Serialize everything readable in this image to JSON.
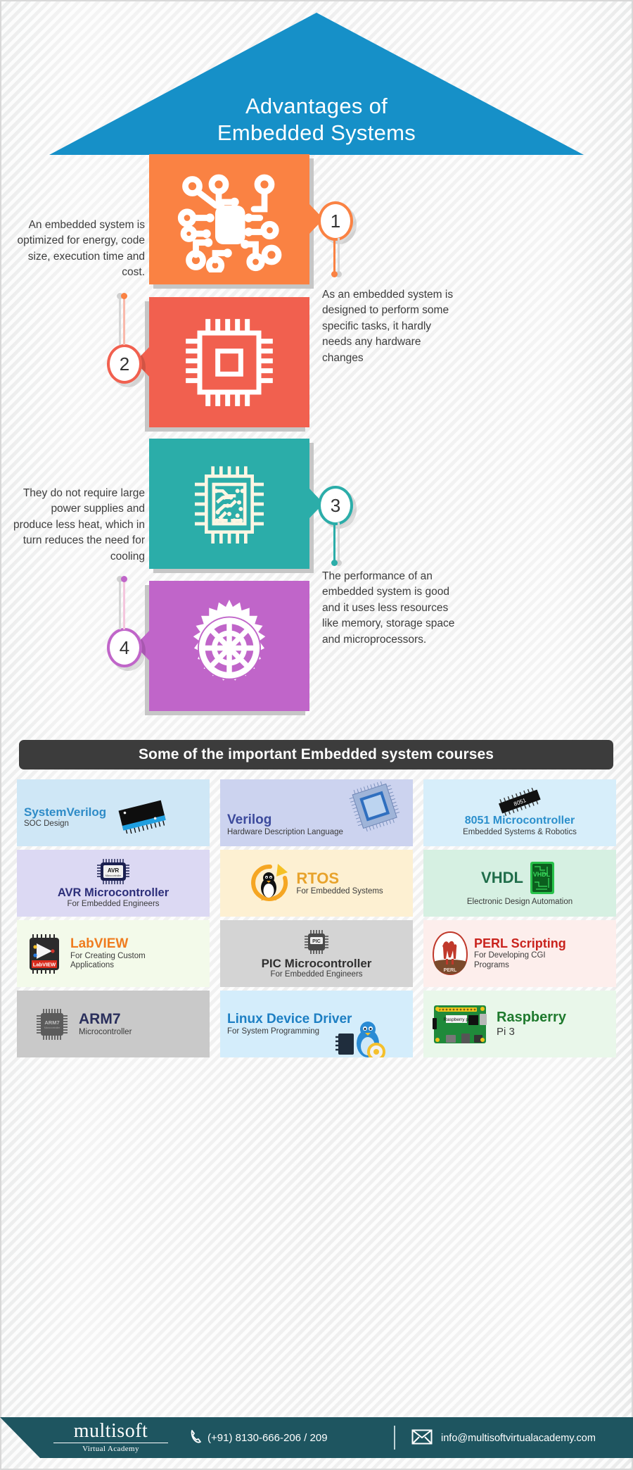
{
  "title": {
    "line1": "Advantages of",
    "line2": "Embedded Systems"
  },
  "accent": {
    "blue": "#1690c8",
    "orange": "#fa8243",
    "red": "#f1604f",
    "teal": "#2bada9",
    "purple": "#c065c9",
    "dark": "#3c3c3c",
    "footer": "#1e5560"
  },
  "points": [
    {
      "number": "1",
      "icon": "circuit-board-icon",
      "color": "#fa8243",
      "text": "An embedded system is optimized for energy, code size, execution time and cost.",
      "side": "left"
    },
    {
      "number": "2",
      "icon": "microchip-icon",
      "color": "#f1604f",
      "text": "As an embedded system is designed to perform some specific tasks, it hardly needs any hardware changes",
      "side": "right"
    },
    {
      "number": "3",
      "icon": "processor-traces-icon",
      "color": "#2bada9",
      "text": "They do not require large power supplies and produce less heat, which in turn reduces the need for cooling",
      "side": "left"
    },
    {
      "number": "4",
      "icon": "gear-icon",
      "color": "#c065c9",
      "text": "The performance of an embedded system is good and it uses less resources like memory, storage space and microprocessors.",
      "side": "right"
    }
  ],
  "courses_banner": "Some of the important Embedded system courses",
  "courses": [
    {
      "name": "SystemVerilog",
      "sub": "SOC Design",
      "bg": "#cfe7f6",
      "name_color": "#2e8bc7",
      "logo": "soc-chip-icon",
      "layout": "text-left"
    },
    {
      "name": "Verilog",
      "sub": "Hardware Description Language",
      "bg": "#ccd3ef",
      "name_color": "#3c4a9c",
      "logo": "bga-chip-icon",
      "layout": "text-left"
    },
    {
      "name": "8051 Microcontroller",
      "sub": "Embedded Systems & Robotics",
      "bg": "#d7eefa",
      "name_color": "#2b8fcc",
      "logo": "dip-chip-8051-icon",
      "layout": "text-below"
    },
    {
      "name": "AVR Microcontroller",
      "sub": "For Embedded Engineers",
      "bg": "#dcd9f3",
      "name_color": "#2d2f7a",
      "logo": "avr-chip-icon",
      "layout": "text-below"
    },
    {
      "name": "RTOS",
      "sub": "For Embedded Systems",
      "bg": "#fdf0d2",
      "name_color": "#e8a32c",
      "logo": "rtos-penguin-icon",
      "layout": "text-right"
    },
    {
      "name": "VHDL",
      "sub": "Electronic Design Automation",
      "bg": "#d6f0e2",
      "name_color": "#1f6d4a",
      "logo": "vhdl-board-icon",
      "layout": "text-left"
    },
    {
      "name": "LabVIEW",
      "sub": "For Creating Custom Applications",
      "bg": "#f3faea",
      "name_color": "#ef7c1f",
      "logo": "labview-chip-icon",
      "layout": "text-right"
    },
    {
      "name": "PIC Microcontroller",
      "sub": "For Embedded Engineers",
      "bg": "#d4d4d4",
      "name_color": "#303030",
      "logo": "pic-chip-icon",
      "layout": "text-below"
    },
    {
      "name": "PERL Scripting",
      "sub": "For Developing CGI Programs",
      "bg": "#fdeeec",
      "name_color": "#c9231d",
      "logo": "perl-camel-icon",
      "layout": "text-right"
    },
    {
      "name": "ARM7",
      "sub": "Microcontroller",
      "bg": "#c9c9c9",
      "name_color": "#2a2f5c",
      "logo": "arm7-chip-icon",
      "layout": "text-right"
    },
    {
      "name": "Linux Device Driver",
      "sub": "For System Programming",
      "bg": "#d4edfb",
      "name_color": "#1d7fc3",
      "logo": "linux-tux-icon",
      "layout": "text-above"
    },
    {
      "name": "Raspberry",
      "sub": "Pi 3",
      "bg": "#e9f7ea",
      "name_color": "#1f7a2e",
      "logo": "raspberry-pi-board-icon",
      "layout": "text-right"
    }
  ],
  "footer": {
    "logo_main": "multisoft",
    "logo_sub": "Virtual Academy",
    "phone_icon": "phone-icon",
    "phone": "(+91) 8130-666-206 / 209",
    "mail_icon": "envelope-icon",
    "email": "info@multisoftvirtualacademy.com"
  }
}
